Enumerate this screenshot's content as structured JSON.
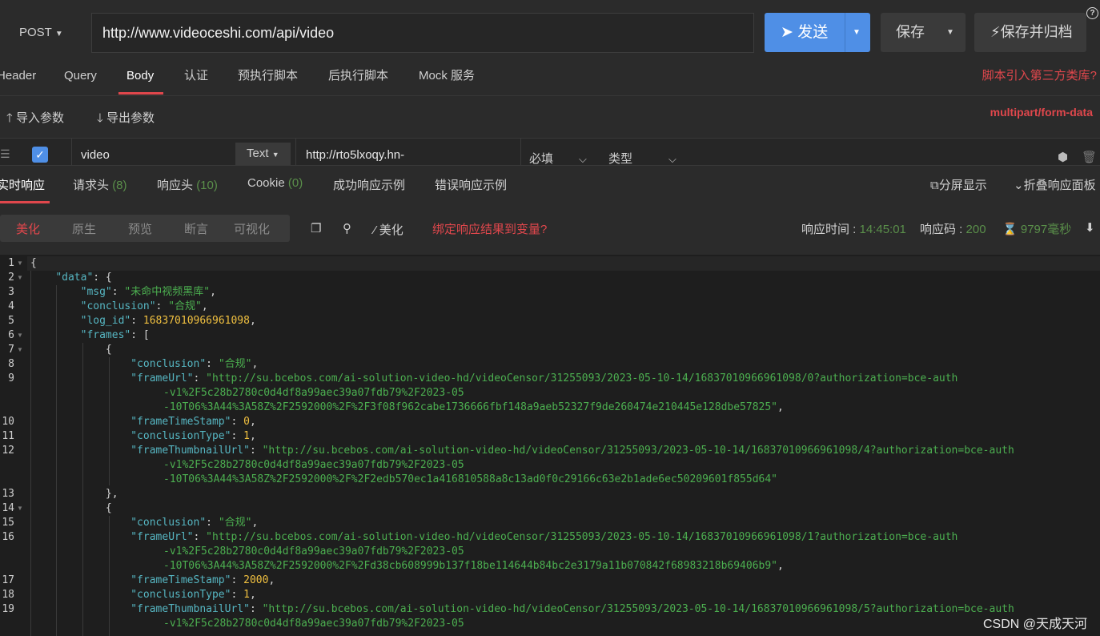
{
  "request": {
    "method": "POST",
    "url": "http://www.videoceshi.com/api/video",
    "send_label": "发送",
    "save_label": "保存",
    "save_archive_label": "保存并归档",
    "help": "?"
  },
  "request_tabs": [
    "Header",
    "Query",
    "Body",
    "认证",
    "预执行脚本",
    "后执行脚本",
    "Mock 服务"
  ],
  "script_link": "脚本引入第三方类库?",
  "tools": {
    "import": "导入参数",
    "export": "导出参数"
  },
  "form_type": "multipart/form-data",
  "param": {
    "key": "video",
    "type": "Text",
    "value": "http://rto5lxoqy.hn-",
    "required": "必填",
    "type_label": "类型"
  },
  "response_tabs": [
    {
      "label": "实时响应",
      "count": ""
    },
    {
      "label": "请求头",
      "count": "(8)"
    },
    {
      "label": "响应头",
      "count": "(10)"
    },
    {
      "label": "Cookie",
      "count": "(0)"
    },
    {
      "label": "成功响应示例",
      "count": ""
    },
    {
      "label": "错误响应示例",
      "count": ""
    }
  ],
  "split_view": "分屏显示",
  "fold_panel": "折叠响应面板",
  "format_tabs": [
    "美化",
    "原生",
    "预览",
    "断言",
    "可视化"
  ],
  "beautify": "美化",
  "bind_result": "绑定响应结果到变量?",
  "meta": {
    "time_label": "响应时间 : ",
    "time_value": "14:45:01",
    "code_label": "响应码 : ",
    "code_value": "200",
    "duration": "9797毫秒"
  },
  "code": {
    "line_numbers": [
      "1",
      "2",
      "3",
      "4",
      "5",
      "6",
      "7",
      "8",
      "9",
      "",
      "",
      "10",
      "11",
      "12",
      "",
      "",
      "13",
      "14",
      "15",
      "16",
      "",
      "",
      "17",
      "18",
      "19",
      ""
    ],
    "msg": "\"未命中视频黑库\"",
    "conclusion": "\"合规\"",
    "log_id": "16837010966961098",
    "frame0_url_1": "\"http://su.bcebos.com/ai-solution-video-hd/videoCensor/31255093/2023-05-10-14/16837010966961098/0?authorization=bce-auth",
    "frame0_url_2": "-v1%2F5c28b2780c0d4df8a99aec39a07fdb79%2F2023-05",
    "frame0_url_3": "-10T06%3A44%3A58Z%2F2592000%2F%2F3f08f962cabe1736666fbf148a9aeb52327f9de260474e210445e128dbe57825\"",
    "frame0_ts": "0",
    "frame0_type": "1",
    "frame0_thumb_1": "\"http://su.bcebos.com/ai-solution-video-hd/videoCensor/31255093/2023-05-10-14/16837010966961098/4?authorization=bce-auth",
    "frame0_thumb_2": "-v1%2F5c28b2780c0d4df8a99aec39a07fdb79%2F2023-05",
    "frame0_thumb_3": "-10T06%3A44%3A58Z%2F2592000%2F%2F2edb570ec1a416810588a8c13ad0f0c29166c63e2b1ade6ec50209601f855d64\"",
    "frame1_url_1": "\"http://su.bcebos.com/ai-solution-video-hd/videoCensor/31255093/2023-05-10-14/16837010966961098/1?authorization=bce-auth",
    "frame1_url_2": "-v1%2F5c28b2780c0d4df8a99aec39a07fdb79%2F2023-05",
    "frame1_url_3": "-10T06%3A44%3A58Z%2F2592000%2F%2Fd38cb608999b137f18be114644b84bc2e3179a11b070842f68983218b69406b9\"",
    "frame1_ts": "2000",
    "frame1_type": "1",
    "frame1_thumb_1": "\"http://su.bcebos.com/ai-solution-video-hd/videoCensor/31255093/2023-05-10-14/16837010966961098/5?authorization=bce-auth",
    "frame1_thumb_2": "-v1%2F5c28b2780c0d4df8a99aec39a07fdb79%2F2023-05"
  },
  "watermark": "CSDN @天成天河",
  "colors": {
    "accent": "#4f8fe6",
    "red": "#e0474c",
    "green": "#4caf50",
    "number": "#f0c040",
    "key": "#56b6c2"
  }
}
